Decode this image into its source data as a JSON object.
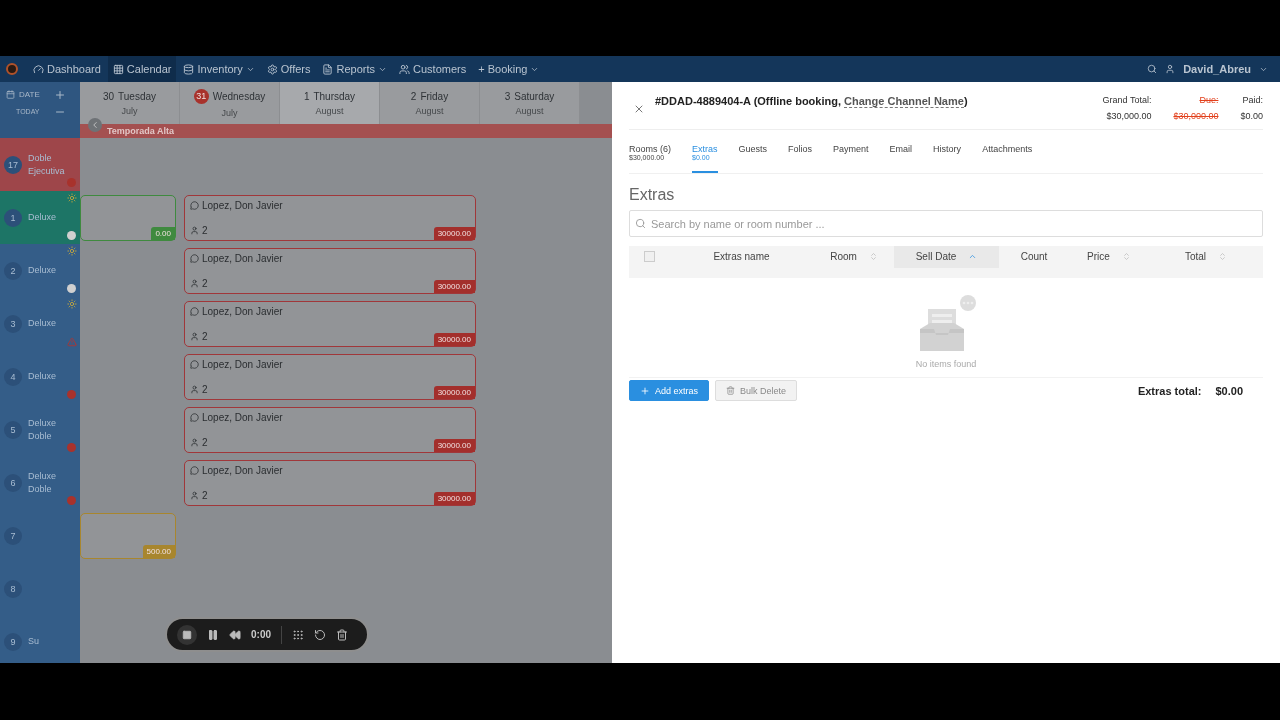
{
  "nav": {
    "items": [
      {
        "label": "Dashboard",
        "dropdown": false,
        "selected": false
      },
      {
        "label": "Calendar",
        "dropdown": false,
        "selected": true
      },
      {
        "label": "Inventory",
        "dropdown": true,
        "selected": false
      },
      {
        "label": "Offers",
        "dropdown": false,
        "selected": false
      },
      {
        "label": "Reports",
        "dropdown": true,
        "selected": false
      },
      {
        "label": "Customers",
        "dropdown": false,
        "selected": false
      },
      {
        "label": "+ Booking",
        "dropdown": true,
        "selected": false
      }
    ],
    "user": "David_Abreu"
  },
  "calendar": {
    "date_label": "DATE",
    "today_label": "TODAY",
    "season": "Temporada Alta",
    "days": [
      {
        "day": "30",
        "weekday": "Tuesday",
        "month": "July",
        "today": false,
        "selected": false
      },
      {
        "day": "31",
        "weekday": "Wednesday",
        "month": "July",
        "today": true,
        "selected": false
      },
      {
        "day": "1",
        "weekday": "Thursday",
        "month": "August",
        "today": false,
        "selected": true
      },
      {
        "day": "2",
        "weekday": "Friday",
        "month": "August",
        "today": false,
        "selected": false
      },
      {
        "day": "3",
        "weekday": "Saturday",
        "month": "August",
        "today": false,
        "selected": false
      }
    ],
    "rooms": [
      {
        "number": "17",
        "name": "Doble Ejecutiva",
        "color": "#9e464a",
        "markers": [
          {
            "kind": "red-dot"
          }
        ]
      },
      {
        "number": "1",
        "name": "Deluxe",
        "color": "#1d7566",
        "markers": [
          {
            "kind": "sun"
          },
          {
            "kind": "white-dot"
          }
        ],
        "bookings": [
          {
            "kind": "paid",
            "amount": "0.00"
          },
          {
            "kind": "unpaid",
            "guest": "Lopez, Don Javier",
            "guests": "2",
            "amount": "30000.00"
          }
        ]
      },
      {
        "number": "2",
        "name": "Deluxe",
        "color": "#345d88",
        "markers": [
          {
            "kind": "sun"
          },
          {
            "kind": "white-dot"
          }
        ],
        "bookings": [
          {
            "kind": "unpaid",
            "guest": "Lopez, Don Javier",
            "guests": "2",
            "amount": "30000.00"
          }
        ]
      },
      {
        "number": "3",
        "name": "Deluxe",
        "color": "#345d88",
        "markers": [
          {
            "kind": "sun"
          },
          {
            "kind": "warning"
          }
        ],
        "bookings": [
          {
            "kind": "unpaid",
            "guest": "Lopez, Don Javier",
            "guests": "2",
            "amount": "30000.00"
          }
        ]
      },
      {
        "number": "4",
        "name": "Deluxe",
        "color": "#345d88",
        "markers": [
          {
            "kind": "red-dot"
          }
        ],
        "bookings": [
          {
            "kind": "unpaid",
            "guest": "Lopez, Don Javier",
            "guests": "2",
            "amount": "30000.00"
          }
        ]
      },
      {
        "number": "5",
        "name": "Deluxe Doble",
        "color": "#345d88",
        "markers": [
          {
            "kind": "red-dot"
          }
        ],
        "bookings": [
          {
            "kind": "unpaid",
            "guest": "Lopez, Don Javier",
            "guests": "2",
            "amount": "30000.00"
          }
        ]
      },
      {
        "number": "6",
        "name": "Deluxe Doble",
        "color": "#345d88",
        "markers": [
          {
            "kind": "red-dot"
          }
        ],
        "bookings": [
          {
            "kind": "unpaid",
            "guest": "Lopez, Don Javier",
            "guests": "2",
            "amount": "30000.00"
          }
        ]
      },
      {
        "number": "7",
        "color": "#345d88",
        "bookings": [
          {
            "kind": "pending",
            "amount": "500.00"
          }
        ]
      },
      {
        "number": "8",
        "color": "#345d88"
      },
      {
        "number": "9",
        "name": "Su",
        "color": "#345d88"
      }
    ]
  },
  "booking": {
    "id": "#DDAD-4889404-A (Offline booking, ",
    "channel_link": "Change Channel Name",
    "id_end": ")",
    "totals": [
      {
        "label": "Grand Total:",
        "value": "$30,000.00",
        "kind": "normal"
      },
      {
        "label": "Due:",
        "value": "$30,000.00",
        "kind": "due"
      },
      {
        "label": "Paid:",
        "value": "$0.00",
        "kind": "normal"
      }
    ],
    "tabs": [
      {
        "label": "Rooms (6)",
        "sub": "$30,000.00",
        "selected": false
      },
      {
        "label": "Extras",
        "sub": "$0.00",
        "selected": true
      },
      {
        "label": "Guests",
        "selected": false
      },
      {
        "label": "Folios",
        "selected": false
      },
      {
        "label": "Payment",
        "selected": false
      },
      {
        "label": "Email",
        "selected": false
      },
      {
        "label": "History",
        "selected": false
      },
      {
        "label": "Attachments",
        "selected": false
      }
    ],
    "section_title": "Extras",
    "search": {
      "placeholder": "Search by name or room number ..."
    },
    "table": {
      "select_all": false,
      "columns": [
        {
          "label": "Extras name",
          "sortable": false
        },
        {
          "label": "Room",
          "sortable": true,
          "sorted": false
        },
        {
          "label": "Sell Date",
          "sortable": true,
          "sorted": true
        },
        {
          "label": "Count",
          "sortable": false
        },
        {
          "label": "Price",
          "sortable": true,
          "sorted": false
        },
        {
          "label": "Total",
          "sortable": true,
          "sorted": false
        }
      ],
      "empty": "No items found"
    },
    "buttons": [
      {
        "label": "Add extras",
        "kind": "primary",
        "disabled": false
      },
      {
        "label": "Bulk Delete",
        "kind": "secondary",
        "disabled": true
      }
    ],
    "extras_total": {
      "label": "Extras total:",
      "value": "$0.00"
    }
  },
  "recorder": {
    "time": "0:00"
  }
}
